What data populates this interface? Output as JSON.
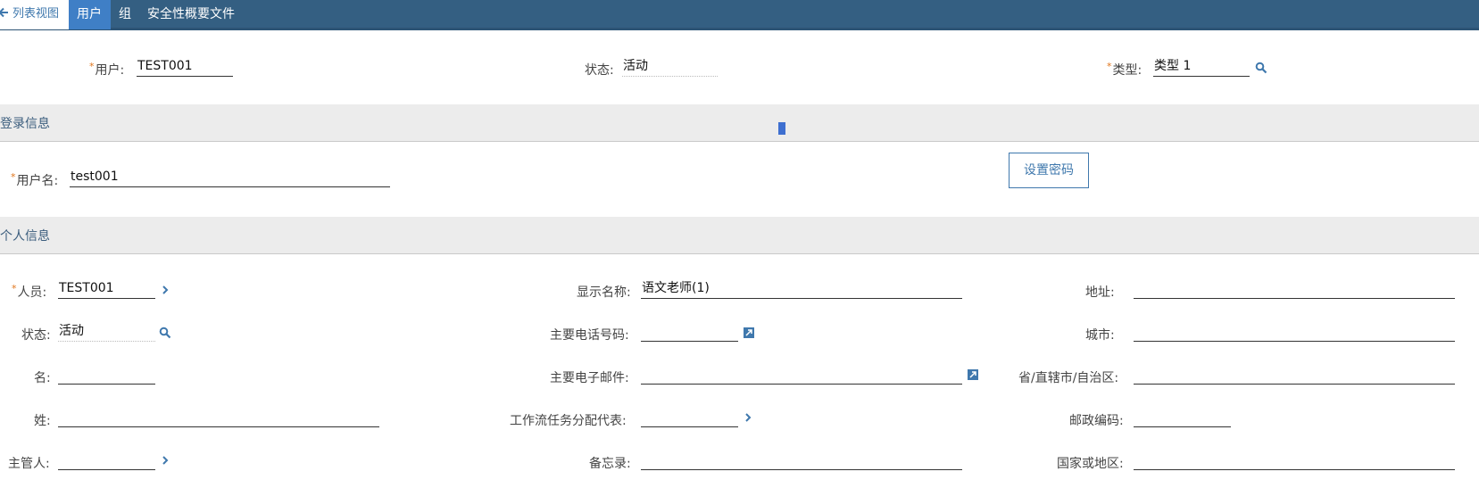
{
  "tabs": {
    "back": "列表视图",
    "user": "用户",
    "group": "组",
    "security": "安全性概要文件"
  },
  "header": {
    "user_label": "用户:",
    "user_value": "TEST001",
    "status_label": "状态:",
    "status_value": "活动",
    "type_label": "类型:",
    "type_value": "类型 1"
  },
  "login": {
    "title": "登录信息",
    "username_label": "用户名:",
    "username_value": "test001",
    "set_password": "设置密码"
  },
  "personal": {
    "title": "个人信息",
    "person_label": "人员:",
    "person_value": "TEST001",
    "status_label": "状态:",
    "status_value": "活动",
    "firstname_label": "名:",
    "firstname_value": "",
    "lastname_label": "姓:",
    "lastname_value": "",
    "manager_label": "主管人:",
    "manager_value": "",
    "display_name_label": "显示名称:",
    "display_name_value": "语文老师(1)",
    "phone_label": "主要电话号码:",
    "phone_value": "",
    "email_label": "主要电子邮件:",
    "email_value": "",
    "delegate_label": "工作流任务分配代表:",
    "delegate_value": "",
    "memo_label": "备忘录:",
    "memo_value": "",
    "address_label": "地址:",
    "address_value": "",
    "city_label": "城市:",
    "city_value": "",
    "province_label": "省/直辖市/自治区:",
    "province_value": "",
    "postal_label": "邮政编码:",
    "postal_value": "",
    "country_label": "国家或地区:",
    "country_value": ""
  },
  "colors": {
    "tabbar": "#345f82",
    "active_tab": "#3f7fc6",
    "link": "#3f78ad",
    "required": "#e0751b",
    "section_bg": "#ececec"
  },
  "icons": {
    "back": "arrow-left-icon",
    "lookup": "magnifier-icon",
    "detail": "chevron-right-icon",
    "launch": "launch-icon"
  }
}
